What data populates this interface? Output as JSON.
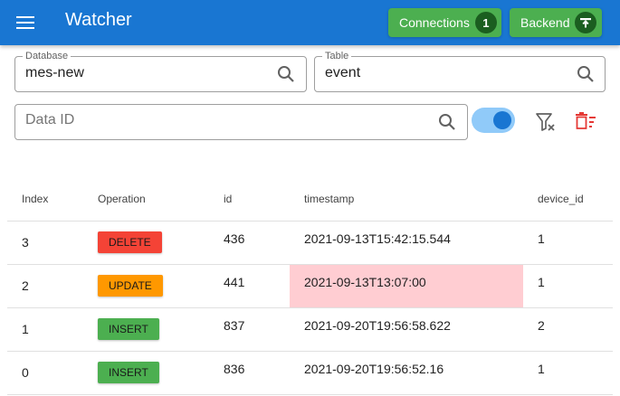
{
  "app": {
    "title": "Watcher"
  },
  "header": {
    "connections": {
      "label": "Connections",
      "count": "1"
    },
    "backend": {
      "label": "Backend"
    }
  },
  "filters": {
    "database": {
      "label": "Database",
      "value": "mes-new"
    },
    "table": {
      "label": "Table",
      "value": "event"
    },
    "data_id": {
      "placeholder": "Data ID",
      "value": ""
    },
    "toggle_on": true
  },
  "colors": {
    "primary": "#1976d2",
    "green": "#4caf50",
    "delete": "#f44336",
    "update": "#ff9800",
    "insert": "#4caf50",
    "highlight": "#ffcdd2",
    "danger_icon": "#e53935"
  },
  "table": {
    "columns": [
      "Index",
      "Operation",
      "id",
      "timestamp",
      "device_id"
    ],
    "rows": [
      {
        "index": "3",
        "operation": "DELETE",
        "id": "436",
        "timestamp": "2021-09-13T15:42:15.544",
        "device_id": "1"
      },
      {
        "index": "2",
        "operation": "UPDATE",
        "id": "441",
        "timestamp": "2021-09-13T13:07:00",
        "device_id": "1"
      },
      {
        "index": "1",
        "operation": "INSERT",
        "id": "837",
        "timestamp": "2021-09-20T19:56:58.622",
        "device_id": "2"
      },
      {
        "index": "0",
        "operation": "INSERT",
        "id": "836",
        "timestamp": "2021-09-20T19:56:52.16",
        "device_id": "1"
      }
    ]
  }
}
